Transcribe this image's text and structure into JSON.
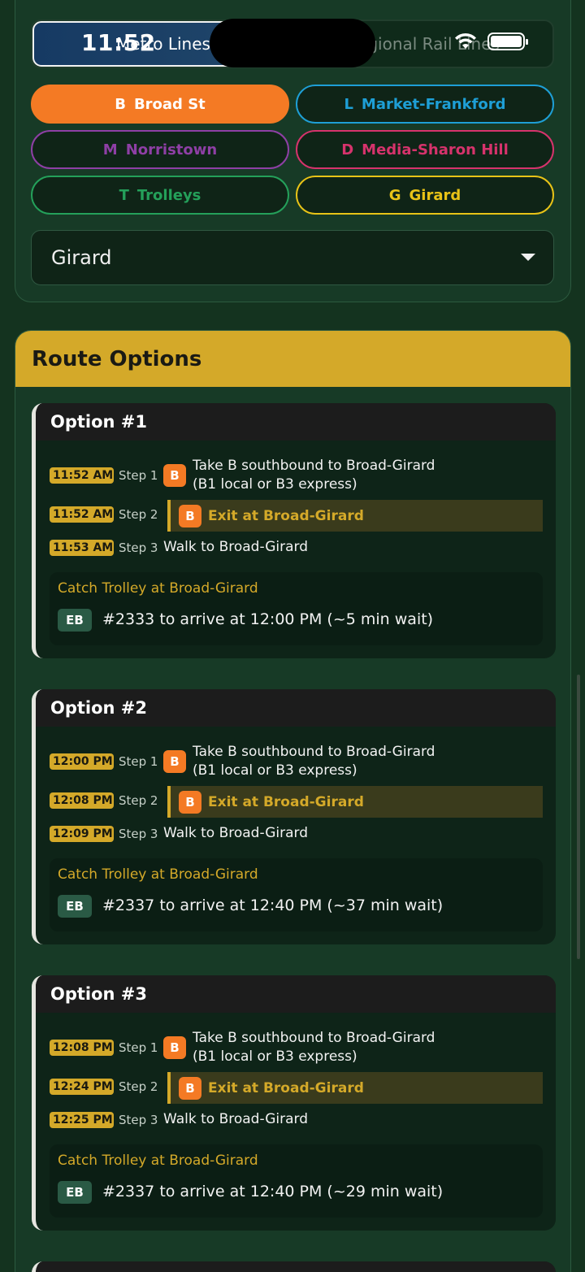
{
  "status_bar": {
    "time": "11:52"
  },
  "mode_toggle": {
    "active": "Metro Lines",
    "inactive": "Regional Rail Lines"
  },
  "lines": [
    {
      "code": "B",
      "name": "Broad St",
      "color": "#f47a24",
      "selected": true
    },
    {
      "code": "L",
      "name": "Market-Frankford",
      "color": "#1e9fd6",
      "selected": false
    },
    {
      "code": "M",
      "name": "Norristown",
      "color": "#8e3fa5",
      "selected": false
    },
    {
      "code": "D",
      "name": "Media-Sharon Hill",
      "color": "#d6336c",
      "selected": false
    },
    {
      "code": "T",
      "name": "Trolleys",
      "color": "#24a05a",
      "selected": false
    },
    {
      "code": "G",
      "name": "Girard",
      "color": "#e8c317",
      "selected": false
    }
  ],
  "station_select": {
    "value": "Girard"
  },
  "route_options": {
    "title": "Route Options",
    "options": [
      {
        "title": "Option #1",
        "steps": [
          {
            "time": "11:52 AM",
            "label": "Step 1",
            "badge": "B",
            "text1": "Take B southbound to Broad-Girard",
            "text2": "(B1 local or B3 express)"
          },
          {
            "time": "11:52 AM",
            "label": "Step 2",
            "badge": "B",
            "text1": "Exit at Broad-Girard"
          },
          {
            "time": "11:53 AM",
            "label": "Step 3",
            "text1": "Walk to Broad-Girard"
          }
        ],
        "catch": {
          "title": "Catch Trolley at Broad-Girard",
          "direction": "EB",
          "text": "#2333 to arrive at 12:00 PM (~5 min wait)"
        }
      },
      {
        "title": "Option #2",
        "steps": [
          {
            "time": "12:00 PM",
            "label": "Step 1",
            "badge": "B",
            "text1": "Take B southbound to Broad-Girard",
            "text2": "(B1 local or B3 express)"
          },
          {
            "time": "12:08 PM",
            "label": "Step 2",
            "badge": "B",
            "text1": "Exit at Broad-Girard"
          },
          {
            "time": "12:09 PM",
            "label": "Step 3",
            "text1": "Walk to Broad-Girard"
          }
        ],
        "catch": {
          "title": "Catch Trolley at Broad-Girard",
          "direction": "EB",
          "text": "#2337 to arrive at 12:40 PM (~37 min wait)"
        }
      },
      {
        "title": "Option #3",
        "steps": [
          {
            "time": "12:08 PM",
            "label": "Step 1",
            "badge": "B",
            "text1": "Take B southbound to Broad-Girard",
            "text2": "(B1 local or B3 express)"
          },
          {
            "time": "12:24 PM",
            "label": "Step 2",
            "badge": "B",
            "text1": "Exit at Broad-Girard"
          },
          {
            "time": "12:25 PM",
            "label": "Step 3",
            "text1": "Walk to Broad-Girard"
          }
        ],
        "catch": {
          "title": "Catch Trolley at Broad-Girard",
          "direction": "EB",
          "text": "#2337 to arrive at 12:40 PM (~29 min wait)"
        }
      }
    ]
  }
}
